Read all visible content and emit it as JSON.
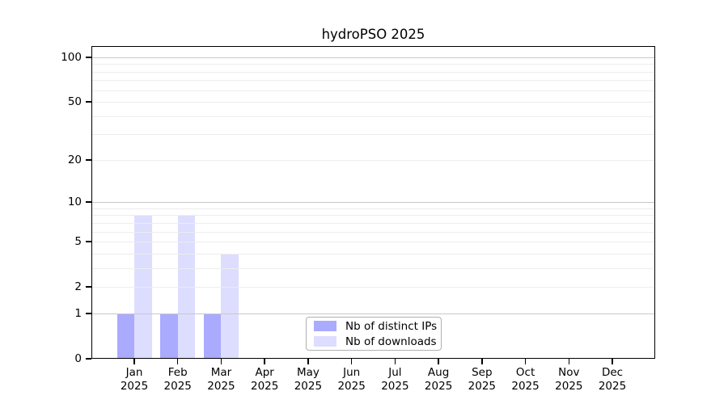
{
  "title": "hydroPSO 2025",
  "colors": {
    "background": "#ffffff",
    "text": "#000000",
    "axis": "#000000",
    "bar_distinct_ips": "#aaaaff",
    "bar_downloads": "#ddddff",
    "grid_major": "#c8c8c8",
    "grid_minor": "#ededed",
    "legend_border": "#b0b0b0"
  },
  "legend": {
    "items": [
      {
        "label": "Nb of distinct IPs",
        "color": "#aaaaff"
      },
      {
        "label": "Nb of downloads",
        "color": "#ddddff"
      }
    ]
  },
  "axes": {
    "y_tick_labels": [
      "100",
      "50",
      "20",
      "10",
      "5",
      "2",
      "1",
      "0"
    ],
    "x_year": "2025"
  },
  "chart_data": {
    "type": "bar",
    "title": "hydroPSO 2025",
    "categories": [
      "Jan 2025",
      "Feb 2025",
      "Mar 2025",
      "Apr 2025",
      "May 2025",
      "Jun 2025",
      "Jul 2025",
      "Aug 2025",
      "Sep 2025",
      "Oct 2025",
      "Nov 2025",
      "Dec 2025"
    ],
    "month_labels": [
      "Jan",
      "Feb",
      "Mar",
      "Apr",
      "May",
      "Jun",
      "Jul",
      "Aug",
      "Sep",
      "Oct",
      "Nov",
      "Dec"
    ],
    "year_label": "2025",
    "series": [
      {
        "name": "Nb of distinct IPs",
        "color": "#aaaaff",
        "values": [
          1,
          1,
          1,
          0,
          0,
          0,
          0,
          0,
          0,
          0,
          0,
          0
        ]
      },
      {
        "name": "Nb of downloads",
        "color": "#ddddff",
        "values": [
          8,
          8,
          4,
          0,
          0,
          0,
          0,
          0,
          0,
          0,
          0,
          0
        ]
      }
    ],
    "xlabel": "",
    "ylabel": "",
    "y_scale": "log1p",
    "ylim": [
      0,
      100
    ],
    "y_ticks": [
      0,
      1,
      2,
      5,
      10,
      20,
      50,
      100
    ],
    "grid": true,
    "grid_values_major": [
      1,
      10,
      100
    ],
    "grid_values_minor": [
      2,
      3,
      4,
      5,
      6,
      7,
      8,
      9,
      20,
      30,
      40,
      50,
      60,
      70,
      80,
      90
    ],
    "legend_position": "inside-bottom-center"
  }
}
